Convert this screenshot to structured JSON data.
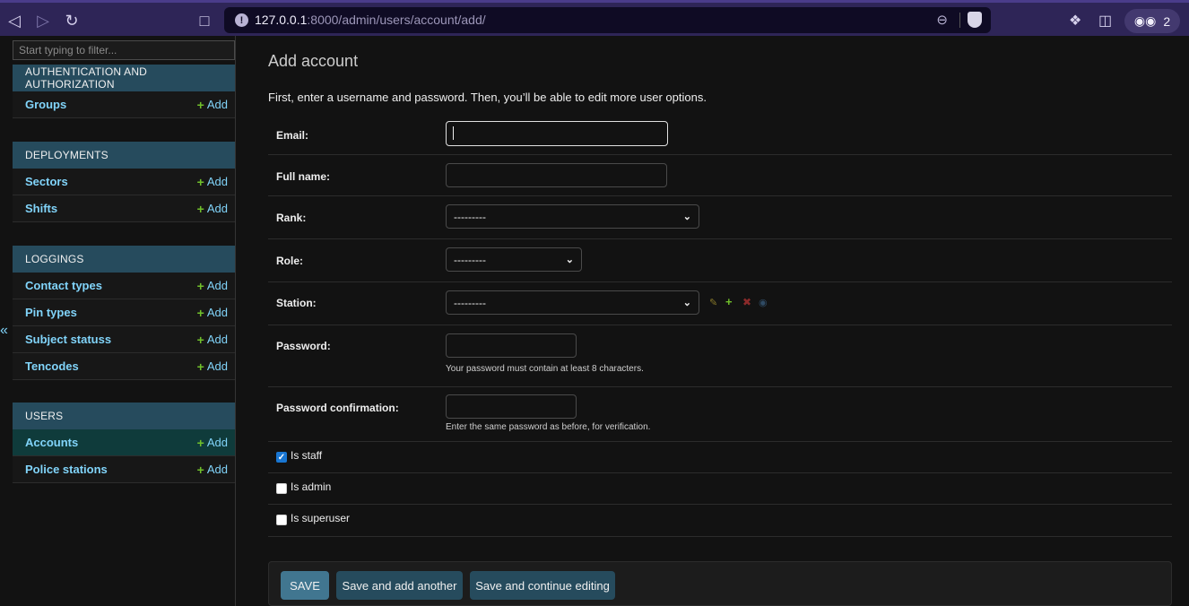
{
  "browser": {
    "url_host": "127.0.0.1",
    "url_path": ":8000/admin/users/account/add/",
    "profile_count": "2"
  },
  "sidebar": {
    "filter_placeholder": "Start typing to filter...",
    "collapse_glyph": "«",
    "add_label": "Add",
    "modules": [
      {
        "caption": "AUTHENTICATION AND AUTHORIZATION",
        "models": [
          "Groups"
        ]
      },
      {
        "caption": "DEPLOYMENTS",
        "models": [
          "Sectors",
          "Shifts"
        ]
      },
      {
        "caption": "LOGGINGS",
        "models": [
          "Contact types",
          "Pin types",
          "Subject statuss",
          "Tencodes"
        ]
      },
      {
        "caption": "USERS",
        "models": [
          "Accounts",
          "Police stations"
        ]
      }
    ]
  },
  "main": {
    "title": "Add account",
    "intro": "First, enter a username and password. Then, you’ll be able to edit more user options.",
    "fields": {
      "email_label": "Email:",
      "fullname_label": "Full name:",
      "rank_label": "Rank:",
      "rank_value": "---------",
      "role_label": "Role:",
      "role_value": "---------",
      "station_label": "Station:",
      "station_value": "---------",
      "password_label": "Password:",
      "password_help": "Your password must contain at least 8 characters.",
      "password2_label": "Password confirmation:",
      "password2_help": "Enter the same password as before, for verification."
    },
    "checkboxes": {
      "is_staff": {
        "label": "Is staff",
        "checked": true
      },
      "is_admin": {
        "label": "Is admin",
        "checked": false
      },
      "is_superuser": {
        "label": "Is superuser",
        "checked": false
      }
    },
    "buttons": {
      "save": "SAVE",
      "save_add": "Save and add another",
      "save_continue": "Save and continue editing"
    }
  },
  "colors": {
    "accent_link": "#81d4fa",
    "module_header": "#264b5d",
    "add_plus": "#70bf2b",
    "browser_chrome": "#2e2557"
  }
}
